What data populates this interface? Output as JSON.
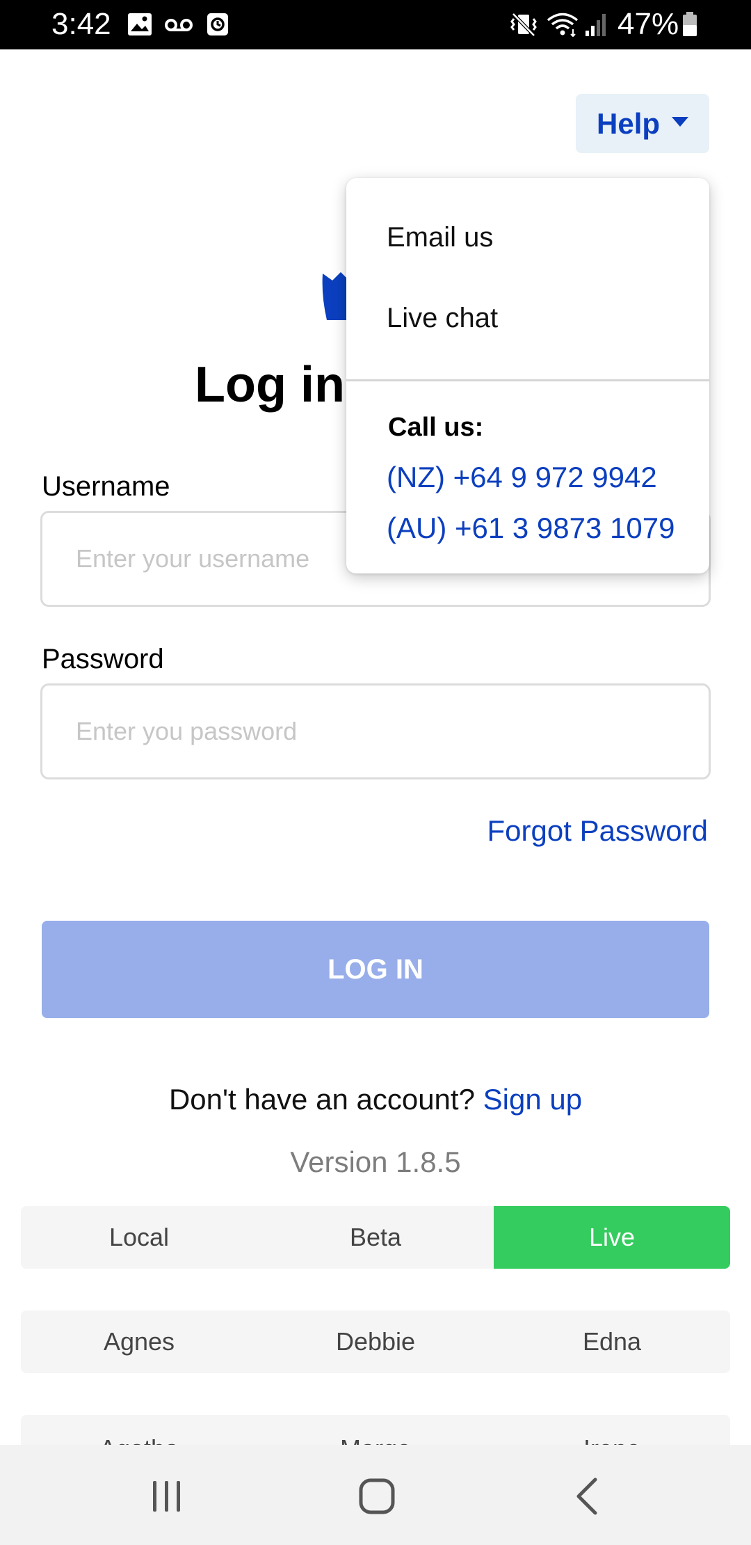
{
  "status_bar": {
    "time": "3:42",
    "battery_percent": "47%",
    "icons": [
      "image-icon",
      "voicemail-icon",
      "clock-app-icon",
      "vibrate-mute-icon",
      "wifi-icon",
      "signal-icon",
      "battery-icon"
    ]
  },
  "help": {
    "label": "Help"
  },
  "title": "Log in",
  "username": {
    "label": "Username",
    "placeholder": "Enter your username",
    "value": ""
  },
  "password": {
    "label": "Password",
    "placeholder": "Enter you password",
    "value": ""
  },
  "forgot_password": "Forgot Password",
  "login_button": "LOG IN",
  "signup": {
    "prompt": "Don't have an account?",
    "link": "Sign up"
  },
  "version": "Version 1.8.5",
  "environments": {
    "items": [
      "Local",
      "Beta",
      "Live"
    ],
    "selected": "Live"
  },
  "users_row_1": [
    "Agnes",
    "Debbie",
    "Edna"
  ],
  "users_row_2": [
    "Agatha",
    "Marge",
    "Irene"
  ],
  "help_menu": {
    "email": "Email us",
    "chat": "Live chat",
    "call_label": "Call us:",
    "phones": [
      "(NZ) +64 9 972 9942",
      "(AU) +61 3 9873 1079"
    ]
  },
  "colors": {
    "brand_blue": "#0b3fbf",
    "login_button": "#98aeea",
    "live_active": "#34cc5e",
    "help_bg": "#e8f1f8"
  }
}
